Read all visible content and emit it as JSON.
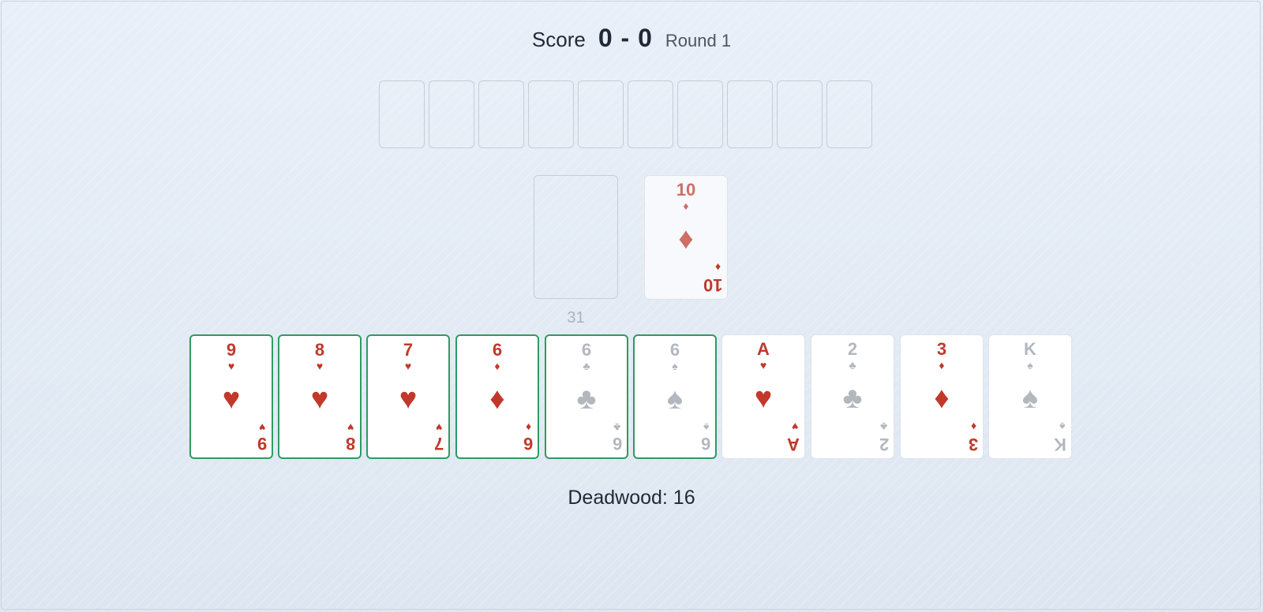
{
  "scoreboard": {
    "label": "Score",
    "value": "0 - 0",
    "round": "Round 1"
  },
  "opponent_hand": {
    "card_count": 10
  },
  "stock": {
    "count": "31"
  },
  "discard": {
    "rank": "10",
    "suit": "♦",
    "color": "red"
  },
  "player_hand": [
    {
      "rank": "9",
      "suit": "♥",
      "color": "red",
      "in_meld": true
    },
    {
      "rank": "8",
      "suit": "♥",
      "color": "red",
      "in_meld": true
    },
    {
      "rank": "7",
      "suit": "♥",
      "color": "red",
      "in_meld": true
    },
    {
      "rank": "6",
      "suit": "♦",
      "color": "red",
      "in_meld": true
    },
    {
      "rank": "6",
      "suit": "♣",
      "color": "gray",
      "in_meld": true
    },
    {
      "rank": "6",
      "suit": "♠",
      "color": "gray",
      "in_meld": true
    },
    {
      "rank": "A",
      "suit": "♥",
      "color": "red",
      "in_meld": false
    },
    {
      "rank": "2",
      "suit": "♣",
      "color": "gray",
      "in_meld": false
    },
    {
      "rank": "3",
      "suit": "♦",
      "color": "red",
      "in_meld": false
    },
    {
      "rank": "K",
      "suit": "♠",
      "color": "gray",
      "in_meld": false
    }
  ],
  "deadwood": {
    "text": "Deadwood: 16"
  },
  "colors": {
    "red_suit": "#c0392b",
    "black_suit_faded": "#b3b8bf",
    "meld_border": "#2e9b61",
    "text": "#1f2937"
  }
}
